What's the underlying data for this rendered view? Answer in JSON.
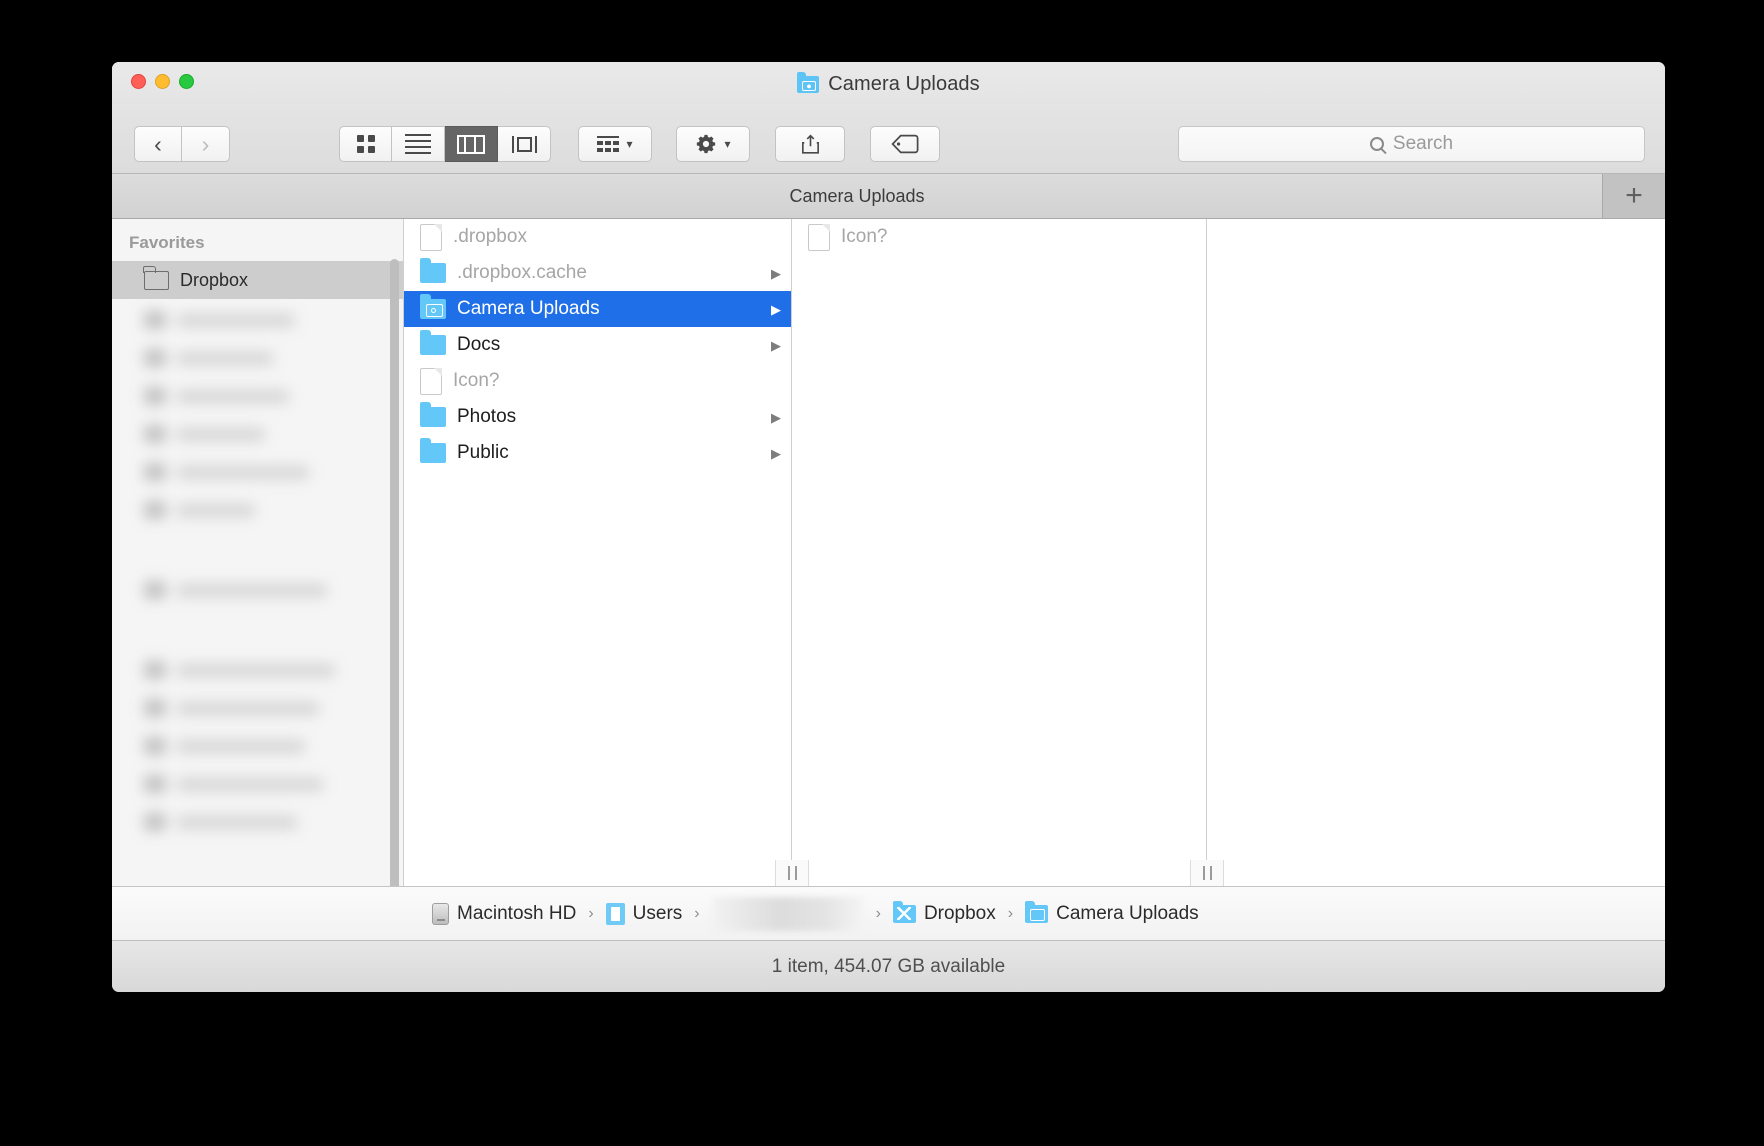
{
  "window": {
    "title": "Camera Uploads",
    "title_icon": "camera-folder-icon",
    "traffic_lights": [
      "close",
      "minimize",
      "zoom"
    ]
  },
  "toolbar": {
    "back_label": "‹",
    "forward_label": "›",
    "view_modes": [
      {
        "name": "icon-view",
        "active": false
      },
      {
        "name": "list-view",
        "active": false
      },
      {
        "name": "column-view",
        "active": true
      },
      {
        "name": "coverflow-view",
        "active": false
      }
    ],
    "arrange_label": "",
    "action_label": "",
    "share_label": "",
    "tags_label": ""
  },
  "search": {
    "placeholder": "Search",
    "value": ""
  },
  "tabs": {
    "items": [
      {
        "label": "Camera Uploads",
        "active": true
      }
    ],
    "new_tab_label": "+"
  },
  "sidebar": {
    "section_title": "Favorites",
    "items": [
      {
        "label": "Dropbox",
        "icon": "folder-icon",
        "selected": true
      }
    ],
    "redacted_sections": [
      {
        "items": 6
      },
      {
        "items": 1
      },
      {
        "items": 5
      }
    ]
  },
  "columns": [
    {
      "name": "dropbox-column",
      "rows": [
        {
          "label": ".dropbox",
          "icon": "document-icon",
          "dim": true,
          "selected": false,
          "has_children": false
        },
        {
          "label": ".dropbox.cache",
          "icon": "folder-icon",
          "dim": true,
          "selected": false,
          "has_children": true
        },
        {
          "label": "Camera Uploads",
          "icon": "camera-folder-icon",
          "dim": false,
          "selected": true,
          "has_children": true
        },
        {
          "label": "Docs",
          "icon": "folder-icon",
          "dim": false,
          "selected": false,
          "has_children": true
        },
        {
          "label": "Icon?",
          "icon": "document-icon",
          "dim": true,
          "selected": false,
          "has_children": false
        },
        {
          "label": "Photos",
          "icon": "folder-icon",
          "dim": false,
          "selected": false,
          "has_children": true
        },
        {
          "label": "Public",
          "icon": "folder-icon",
          "dim": false,
          "selected": false,
          "has_children": true
        }
      ]
    },
    {
      "name": "camera-uploads-column",
      "rows": [
        {
          "label": "Icon?",
          "icon": "document-icon",
          "dim": true,
          "selected": false,
          "has_children": false
        }
      ]
    },
    {
      "name": "preview-column",
      "rows": []
    }
  ],
  "pathbar": {
    "crumbs": [
      {
        "label": "Macintosh HD",
        "icon": "hard-drive-icon"
      },
      {
        "label": "Users",
        "icon": "user-folder-icon"
      },
      {
        "label": "",
        "icon": "redacted-username"
      },
      {
        "label": "Dropbox",
        "icon": "dropbox-folder-icon"
      },
      {
        "label": "Camera Uploads",
        "icon": "camera-folder-icon"
      }
    ],
    "separator": "›"
  },
  "statusbar": {
    "text": "1 item, 454.07 GB available"
  },
  "colors": {
    "selection_blue": "#1e6fe8",
    "folder_blue": "#63c7f7",
    "window_chrome": "#ececec"
  }
}
